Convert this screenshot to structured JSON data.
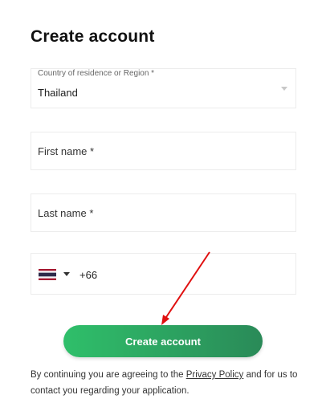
{
  "page": {
    "title": "Create account"
  },
  "form": {
    "country": {
      "label": "Country of residence or Region *",
      "value": "Thailand"
    },
    "first_name": {
      "placeholder": "First name *"
    },
    "last_name": {
      "placeholder": "Last name *"
    },
    "phone": {
      "dial_code": "+66",
      "flag": "thailand-flag"
    }
  },
  "button": {
    "label": "Create account"
  },
  "consent": {
    "before": "By continuing you are agreeing to the ",
    "link": "Privacy Policy",
    "after": " and for us to contact you regarding your application."
  },
  "colors": {
    "button_start": "#2fbf6a",
    "button_end": "#2a8a58",
    "arrow": "#e01010"
  }
}
